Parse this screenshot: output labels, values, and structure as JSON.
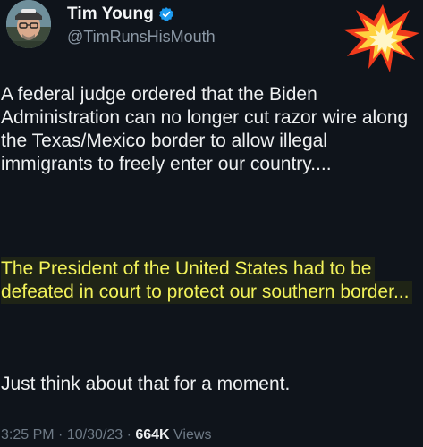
{
  "author": {
    "display_name": "Tim Young",
    "handle": "@TimRunsHisMouth",
    "verified": true,
    "avatar_icon": "profile-photo"
  },
  "decoration": {
    "icon": "explosion-emoji"
  },
  "tweet": {
    "paragraph1": "A federal judge ordered that the Biden Administration can no longer cut razor wire along the Texas/Mexico border to allow illegal immigrants to freely enter our country....",
    "paragraph2": "The President of the United States had to be defeated in court to protect our southern border...",
    "paragraph3": "Just think about that for a moment."
  },
  "meta": {
    "time": "3:25 PM",
    "date": "10/30/23",
    "views_count": "664K",
    "views_label": "Views",
    "separator": "·"
  },
  "colors": {
    "background": "#0f141b",
    "text": "#eef0f1",
    "highlight_text": "#f2f25a",
    "secondary_text": "#8b98a5",
    "verified_blue": "#1d9bf0"
  }
}
